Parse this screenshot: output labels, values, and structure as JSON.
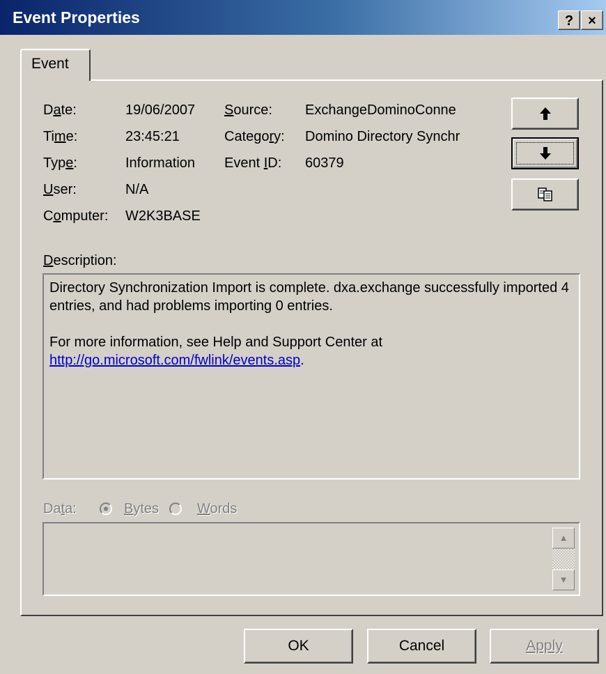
{
  "window": {
    "title": "Event Properties",
    "help": "?",
    "close": "×"
  },
  "tab": {
    "label": "Event"
  },
  "fields": {
    "date": {
      "label_pre": "D",
      "label_acc": "a",
      "label_post": "te:",
      "value": "19/06/2007"
    },
    "time": {
      "label_pre": "Ti",
      "label_acc": "m",
      "label_post": "e:",
      "value": "23:45:21"
    },
    "type": {
      "label_pre": "Typ",
      "label_acc": "e",
      "label_post": ":",
      "value": "Information"
    },
    "user": {
      "label_pre": "",
      "label_acc": "U",
      "label_post": "ser:",
      "value": "N/A"
    },
    "computer": {
      "label_pre": "C",
      "label_acc": "o",
      "label_post": "mputer:",
      "value": "W2K3BASE"
    },
    "source": {
      "label_pre": "",
      "label_acc": "S",
      "label_post": "ource:",
      "value": "ExchangeDominoConne"
    },
    "category": {
      "label_pre": "Catego",
      "label_acc": "r",
      "label_post": "y:",
      "value": "Domino Directory Synchr"
    },
    "event_id": {
      "label_pre": "Event ",
      "label_acc": "I",
      "label_post": "D:",
      "value": "60379"
    }
  },
  "nav": {
    "up_icon": "arrow-up-icon",
    "down_icon": "arrow-down-icon",
    "copy_icon": "copy-icon"
  },
  "description": {
    "label_acc": "D",
    "label_post": "escription:",
    "line1": "Directory Synchronization Import is complete. dxa.exchange successfully imported 4 entries, and had problems importing 0 entries.",
    "line2_text": "For more information, see Help and Support Center at ",
    "link": "http://go.microsoft.com/fwlink/events.asp",
    "line2_end": "."
  },
  "data": {
    "label_pre": "Da",
    "label_acc": "t",
    "label_post": "a:",
    "bytes_acc": "B",
    "bytes_post": "ytes",
    "words_acc": "W",
    "words_post": "ords",
    "selected": "Bytes"
  },
  "buttons": {
    "ok": "OK",
    "cancel": "Cancel",
    "apply": "Apply"
  }
}
